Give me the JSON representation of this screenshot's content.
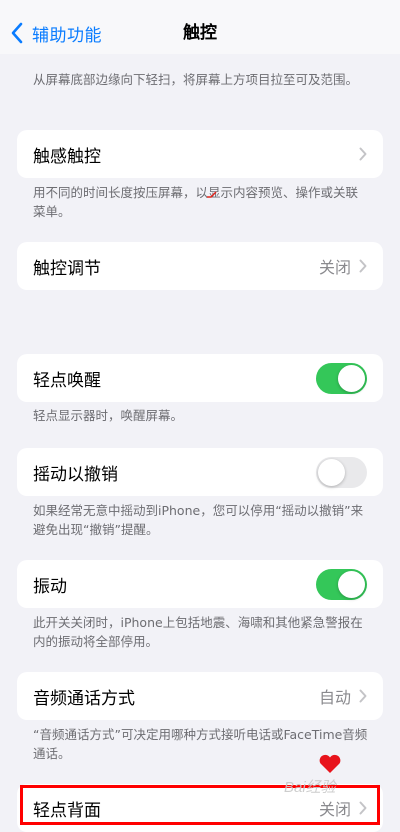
{
  "nav": {
    "back_label": "辅助功能",
    "title": "触控"
  },
  "top_footnote": "从屏幕底部边缘向下轻扫，将屏幕上方项目拉至可及范围。",
  "haptic": {
    "label": "触感触控",
    "footnote": "用不同的时间长度按压屏幕，以显示内容预览、操作或关联菜单。"
  },
  "touch_accommodations": {
    "label": "触控调节",
    "value": "关闭"
  },
  "tap_to_wake": {
    "label": "轻点唤醒",
    "on": true,
    "footnote": "轻点显示器时，唤醒屏幕。"
  },
  "shake_to_undo": {
    "label": "摇动以撤销",
    "on": false,
    "footnote": "如果经常无意中摇动到iPhone，您可以停用“摇动以撤销”来避免出现“撤销”提醒。"
  },
  "vibration": {
    "label": "振动",
    "on": true,
    "footnote": "此开关关闭时，iPhone上包括地震、海啸和其他紧急警报在内的振动将全部停用。"
  },
  "call_audio_routing": {
    "label": "音频通话方式",
    "value": "自动",
    "footnote": "“音频通话方式”可决定用哪种方式接听电话或FaceTime音频通话。"
  },
  "back_tap": {
    "label": "轻点背面",
    "value": "关闭"
  },
  "watermark": {
    "text": "Bai经验"
  },
  "colors": {
    "accent": "#0a7cff",
    "switch_on": "#34c759",
    "highlight": "#ff0000"
  }
}
